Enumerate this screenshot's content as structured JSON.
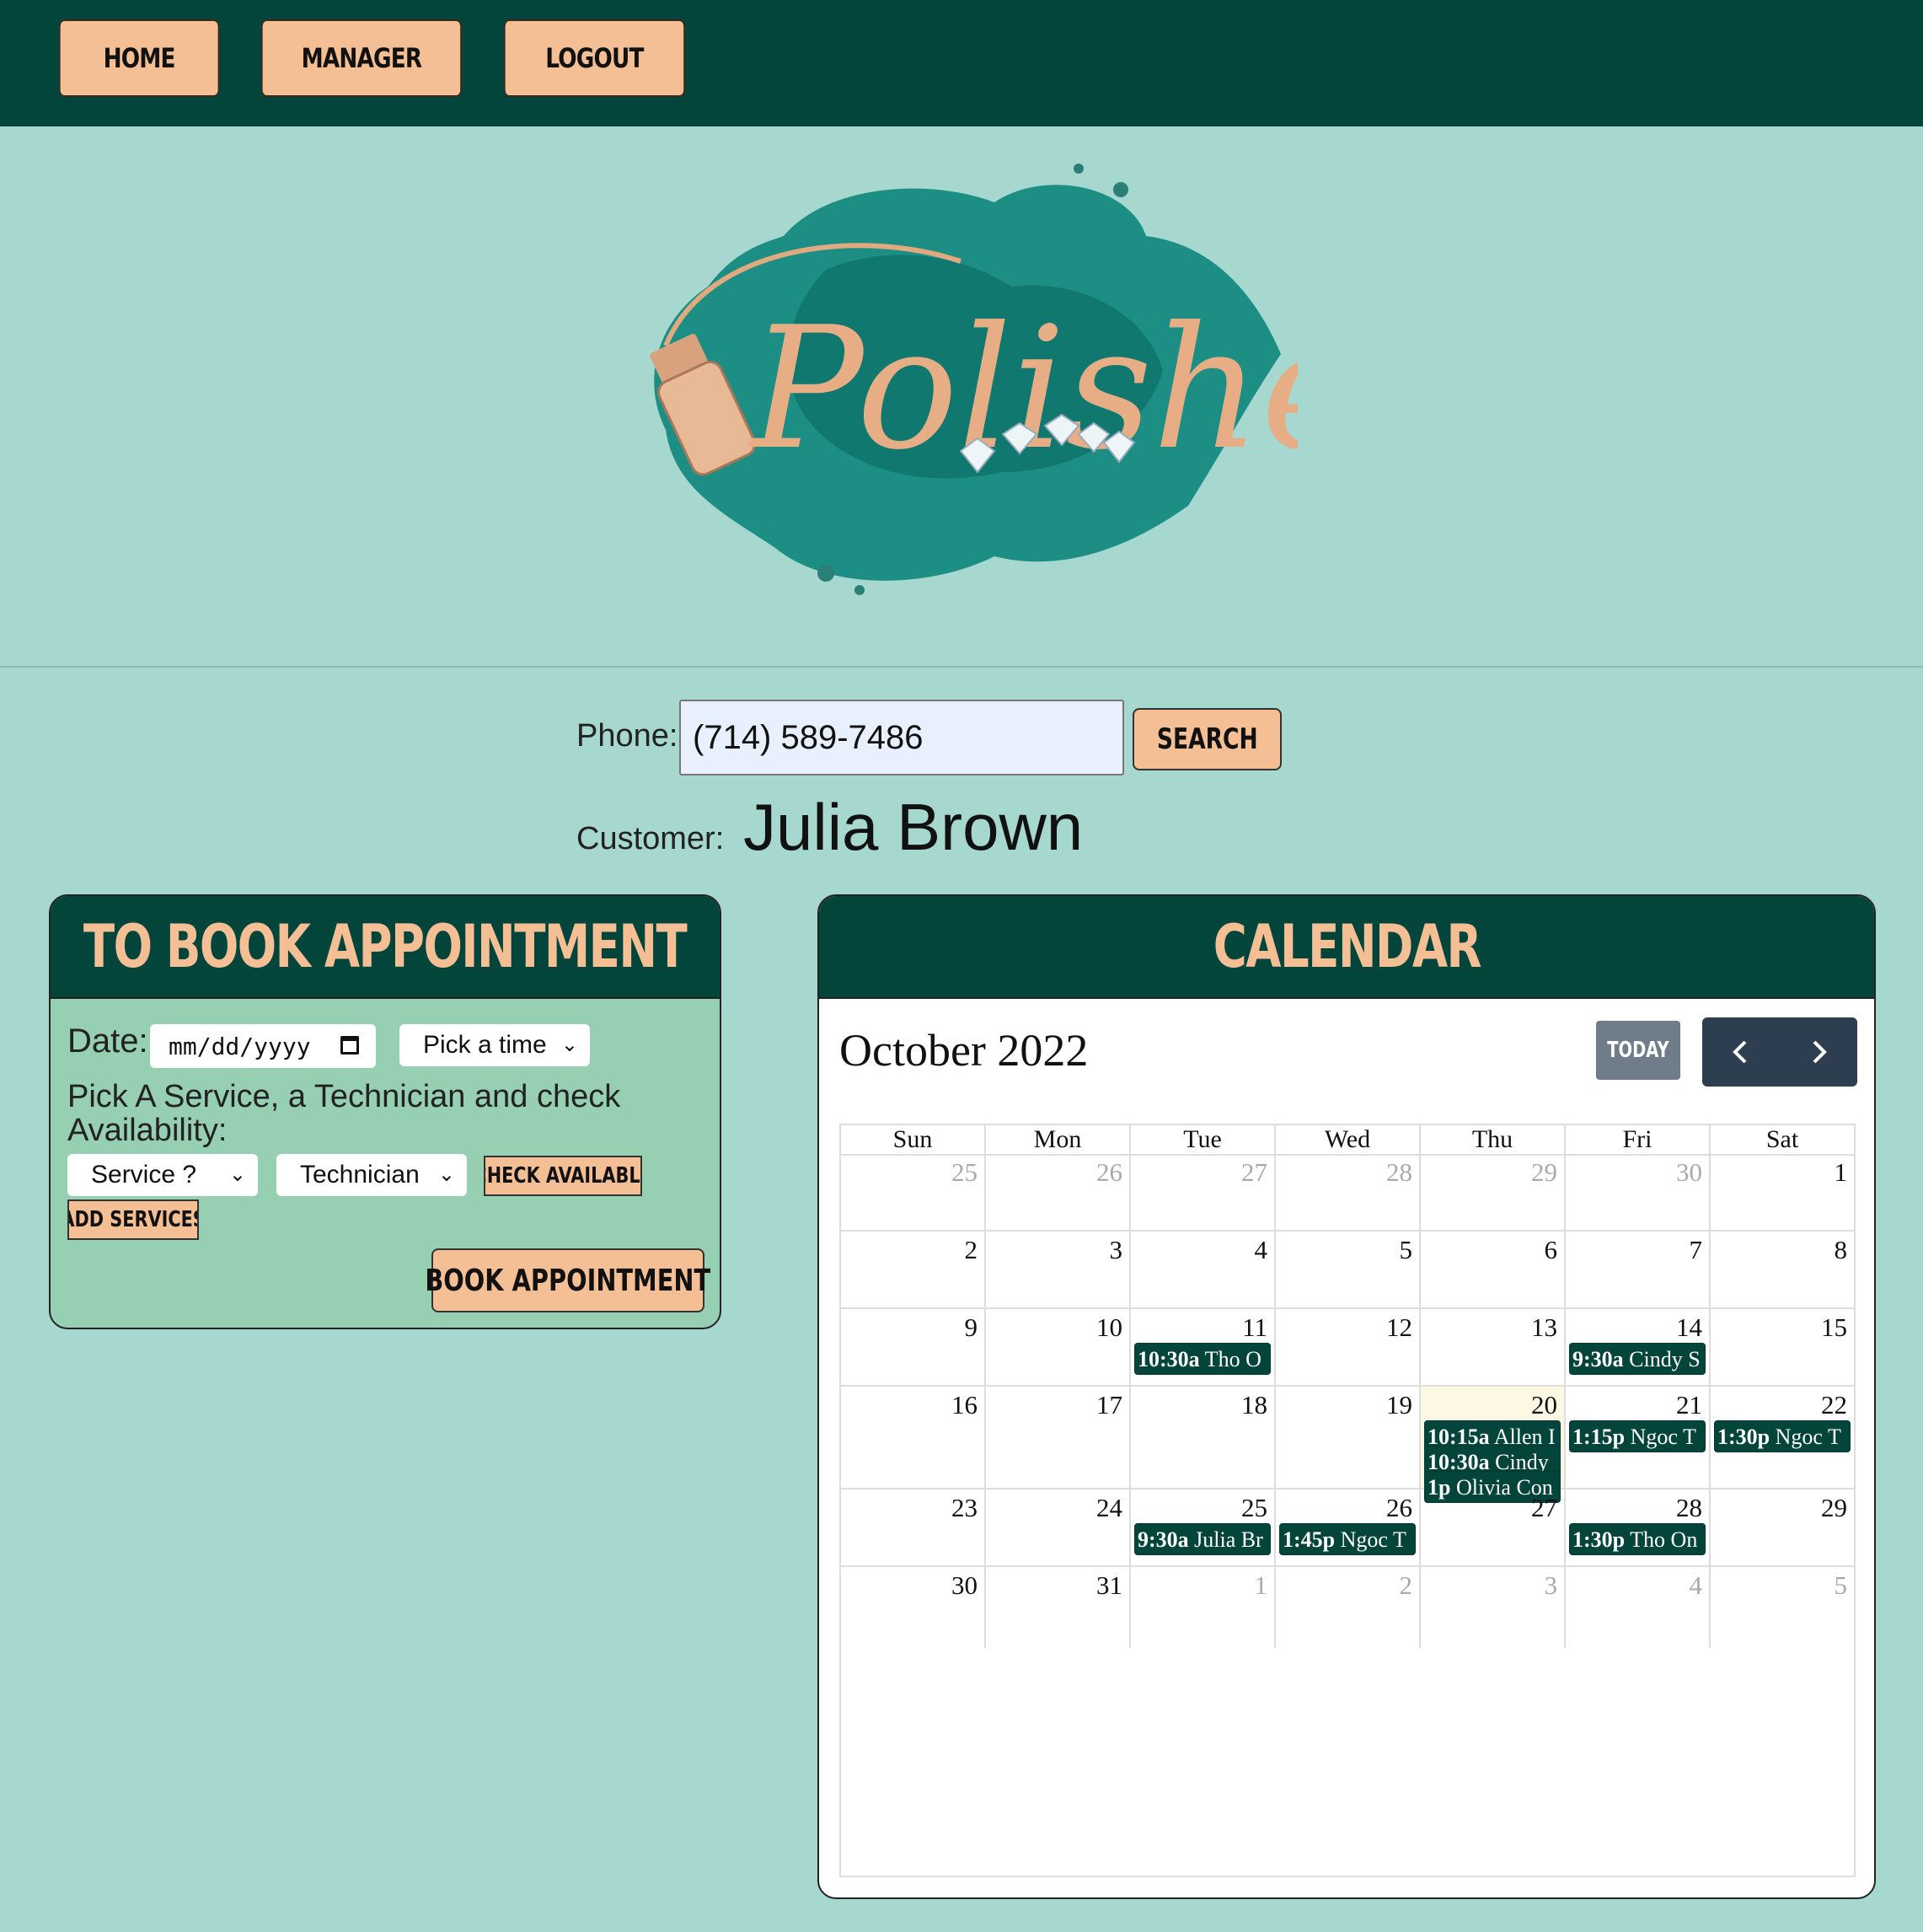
{
  "nav": {
    "home_label": "HOME",
    "manager_label": "MANAGER",
    "logout_label": "LOGOUT"
  },
  "logo": {
    "text": "Polished"
  },
  "search": {
    "phone_label": "Phone:",
    "phone_value": "(714) 589-7486",
    "search_label": "SEARCH"
  },
  "customer": {
    "label": "Customer:",
    "name": "Julia Brown"
  },
  "booking": {
    "title": "TO BOOK APPOINTMENT",
    "date_label": "Date:",
    "date_placeholder": "mm/dd/yyyy",
    "time_select": "Pick a time",
    "availability_text": "Pick A Service, a Technician and check Availability:",
    "service_select": "Service ?",
    "technician_select": "Technician",
    "check_label": "CHECK AVAILABLE",
    "add_services_label": "ADD SERVICES",
    "book_label": "BOOK APPOINTMENT"
  },
  "calendar": {
    "title": "CALENDAR",
    "month_title": "October 2022",
    "today_label": "TODAY",
    "weekdays": [
      "Sun",
      "Mon",
      "Tue",
      "Wed",
      "Thu",
      "Fri",
      "Sat"
    ],
    "weeks": [
      [
        {
          "d": "25",
          "o": true
        },
        {
          "d": "26",
          "o": true
        },
        {
          "d": "27",
          "o": true
        },
        {
          "d": "28",
          "o": true
        },
        {
          "d": "29",
          "o": true
        },
        {
          "d": "30",
          "o": true
        },
        {
          "d": "1"
        }
      ],
      [
        {
          "d": "2"
        },
        {
          "d": "3"
        },
        {
          "d": "4"
        },
        {
          "d": "5"
        },
        {
          "d": "6"
        },
        {
          "d": "7"
        },
        {
          "d": "8"
        }
      ],
      [
        {
          "d": "9"
        },
        {
          "d": "10"
        },
        {
          "d": "11",
          "ev": [
            [
              "10:30a",
              "Tho O"
            ]
          ]
        },
        {
          "d": "12"
        },
        {
          "d": "13"
        },
        {
          "d": "14",
          "ev": [
            [
              "9:30a",
              "Cindy S"
            ]
          ]
        },
        {
          "d": "15"
        }
      ],
      [
        {
          "d": "16"
        },
        {
          "d": "17"
        },
        {
          "d": "18"
        },
        {
          "d": "19"
        },
        {
          "d": "20",
          "today": true,
          "ev": [
            [
              "10:15a",
              "Allen I"
            ],
            [
              "10:30a",
              "Cindy"
            ],
            [
              "1p",
              "Olivia Con"
            ]
          ]
        },
        {
          "d": "21",
          "ev": [
            [
              "1:15p",
              "Ngoc T"
            ]
          ]
        },
        {
          "d": "22",
          "ev": [
            [
              "1:30p",
              "Ngoc T"
            ]
          ]
        }
      ],
      [
        {
          "d": "23"
        },
        {
          "d": "24"
        },
        {
          "d": "25",
          "ev": [
            [
              "9:30a",
              "Julia Br"
            ]
          ]
        },
        {
          "d": "26",
          "ev": [
            [
              "1:45p",
              "Ngoc T"
            ]
          ]
        },
        {
          "d": "27"
        },
        {
          "d": "28",
          "ev": [
            [
              "1:30p",
              "Tho On"
            ]
          ]
        },
        {
          "d": "29"
        }
      ],
      [
        {
          "d": "30"
        },
        {
          "d": "31"
        },
        {
          "d": "1",
          "o": true
        },
        {
          "d": "2",
          "o": true
        },
        {
          "d": "3",
          "o": true
        },
        {
          "d": "4",
          "o": true
        },
        {
          "d": "5",
          "o": true
        }
      ]
    ]
  },
  "colors": {
    "header_bg": "#03453b",
    "page_bg": "#a7d8cf",
    "accent": "#f5bf95",
    "panel_bg": "#97cfb3",
    "event_bg": "#03453b",
    "today_bg": "#fcf8e3"
  }
}
